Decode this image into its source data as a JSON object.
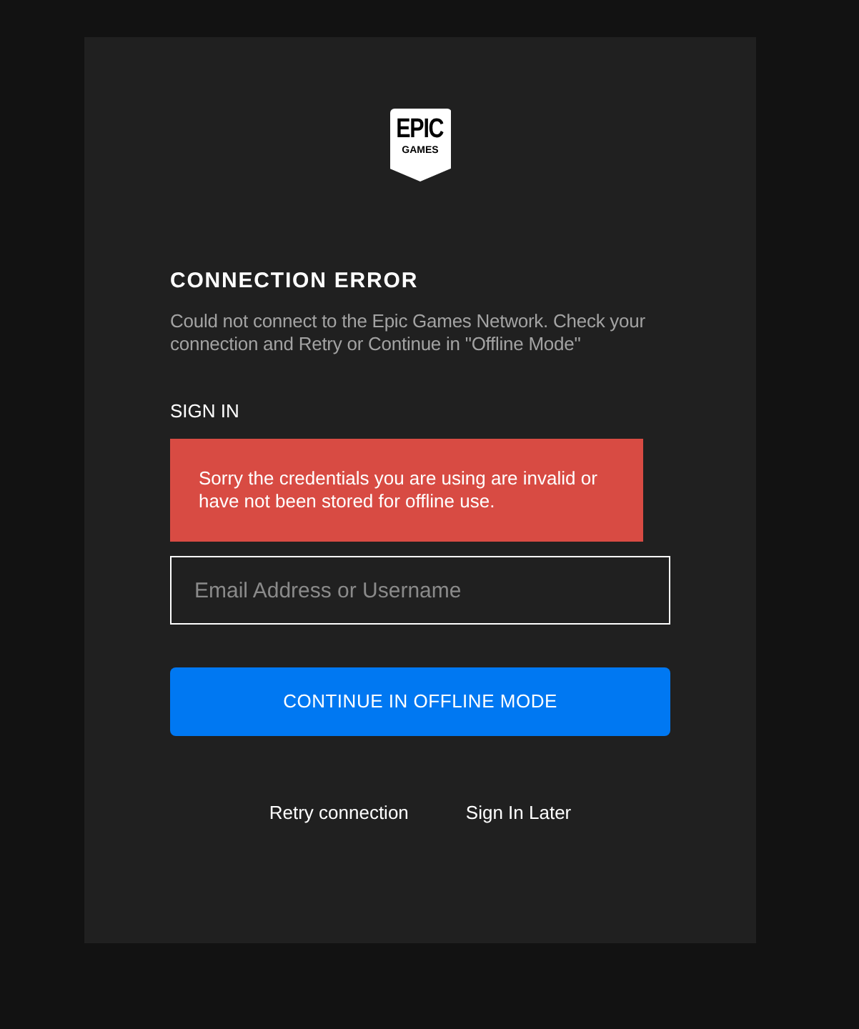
{
  "logo": {
    "lines": [
      "EPIC",
      "GAMES"
    ]
  },
  "title": "CONNECTION ERROR",
  "message": "Could not connect to the Epic Games Network. Check your connection and Retry or Continue in \"Offline Mode\"",
  "sign_in": {
    "heading": "SIGN IN",
    "error": "Sorry the credentials you are using are invalid or have not been stored for offline use.",
    "email_field": {
      "placeholder": "Email Address or Username"
    }
  },
  "primary_button": "CONTINUE IN OFFLINE MODE",
  "links": [
    "Retry connection",
    "Sign In Later"
  ]
}
